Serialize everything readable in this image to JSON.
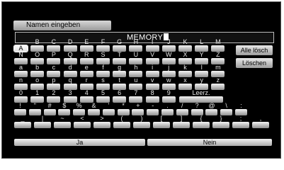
{
  "dialog": {
    "title": "Namen eingeben",
    "input_value": "MEMORY"
  },
  "rows": [
    [
      "A",
      "B",
      "C",
      "D",
      "E",
      "F",
      "G",
      "H",
      "I",
      "J",
      "K",
      "L",
      "M"
    ],
    [
      "N",
      "O",
      "P",
      "Q",
      "R",
      "S",
      "T",
      "U",
      "V",
      "W",
      "X",
      "Y",
      "Z"
    ],
    [
      "a",
      "b",
      "c",
      "d",
      "e",
      "f",
      "g",
      "h",
      "i",
      "j",
      "k",
      "l",
      "m"
    ],
    [
      "n",
      "o",
      "p",
      "q",
      "r",
      "s",
      "t",
      "u",
      "v",
      "w",
      "x",
      "y",
      "z"
    ],
    [
      "0",
      "1",
      "2",
      "3",
      "4",
      "5",
      "6",
      "7",
      "8",
      "9"
    ],
    [
      "!",
      "\"",
      "#",
      "$",
      "%",
      "&",
      "'",
      "*",
      "+",
      "-",
      ".",
      "/",
      "?",
      "@",
      "\\",
      ":"
    ],
    [
      "_",
      "|",
      "~",
      "<",
      ">",
      "(",
      ")",
      "[",
      "]",
      "{",
      "}",
      ";",
      ","
    ]
  ],
  "special_keys": {
    "space": "Leerz.",
    "delete_all": "Alle lösch",
    "delete": "Löschen"
  },
  "buttons": {
    "yes": "Ja",
    "no": "Nein"
  }
}
